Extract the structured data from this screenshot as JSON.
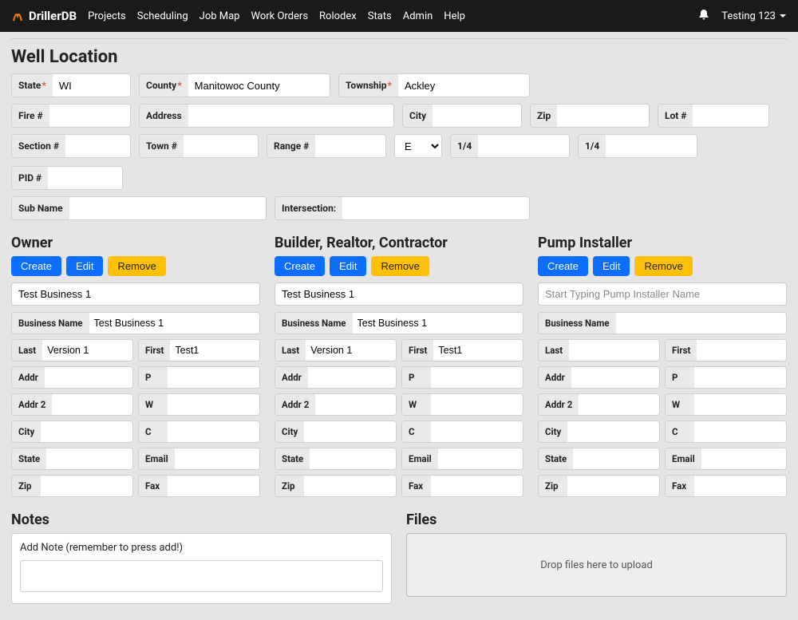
{
  "app": {
    "brand": "DrillerDB"
  },
  "nav": {
    "projects": "Projects",
    "scheduling": "Scheduling",
    "jobmap": "Job Map",
    "workorders": "Work Orders",
    "rolodex": "Rolodex",
    "stats": "Stats",
    "admin": "Admin",
    "help": "Help"
  },
  "user": {
    "name": "Testing 123"
  },
  "section": {
    "wellLocation": "Well Location",
    "owner": "Owner",
    "brc": "Builder, Realtor, Contractor",
    "pump": "Pump Installer",
    "notes": "Notes",
    "files": "Files"
  },
  "labels": {
    "state": "State",
    "county": "County",
    "township": "Township",
    "fire": "Fire #",
    "address": "Address",
    "city": "City",
    "zip": "Zip",
    "lot": "Lot #",
    "section": "Section #",
    "town": "Town #",
    "range": "Range #",
    "quarter": "1/4",
    "pid": "PID #",
    "sub": "Sub Name",
    "intersection": "Intersection:",
    "businessName": "Business Name",
    "last": "Last",
    "first": "First",
    "addr": "Addr",
    "addr2": "Addr 2",
    "c": "C",
    "p": "P",
    "w": "W",
    "stateShort": "State",
    "email": "Email",
    "fax": "Fax",
    "cityShort": "City",
    "zipShort": "Zip",
    "addNote": "Add Note (remember to press add!)",
    "dropFiles": "Drop files here to upload"
  },
  "placeholders": {
    "pumpSearch": "Start Typing Pump Installer Name"
  },
  "buttons": {
    "create": "Create",
    "edit": "Edit",
    "remove": "Remove"
  },
  "wellLocation": {
    "state": "WI",
    "county": "Manitowoc County",
    "township": "Ackley",
    "fire": "",
    "address": "",
    "city": "",
    "zip": "",
    "lot": "",
    "section": "",
    "town": "",
    "range": "",
    "rangeDir": "E",
    "quarter1": "",
    "quarter2": "",
    "pid": "",
    "sub": "",
    "intersection": ""
  },
  "owner": {
    "search": "Test Business 1",
    "businessName": "Test Business 1",
    "last": "Version 1",
    "first": "Test1",
    "addr": "",
    "addr2": "",
    "city": "",
    "state": "",
    "zip": "",
    "p": "",
    "w": "",
    "c": "",
    "email": "",
    "fax": ""
  },
  "brc": {
    "search": "Test Business 1",
    "businessName": "Test Business 1",
    "last": "Version 1",
    "first": "Test1",
    "addr": "",
    "addr2": "",
    "city": "",
    "state": "",
    "zip": "",
    "p": "",
    "w": "",
    "c": "",
    "email": "",
    "fax": ""
  },
  "pump": {
    "search": "",
    "businessName": "",
    "last": "",
    "first": "",
    "addr": "",
    "addr2": "",
    "city": "",
    "state": "",
    "zip": "",
    "p": "",
    "w": "",
    "c": "",
    "email": "",
    "fax": ""
  }
}
